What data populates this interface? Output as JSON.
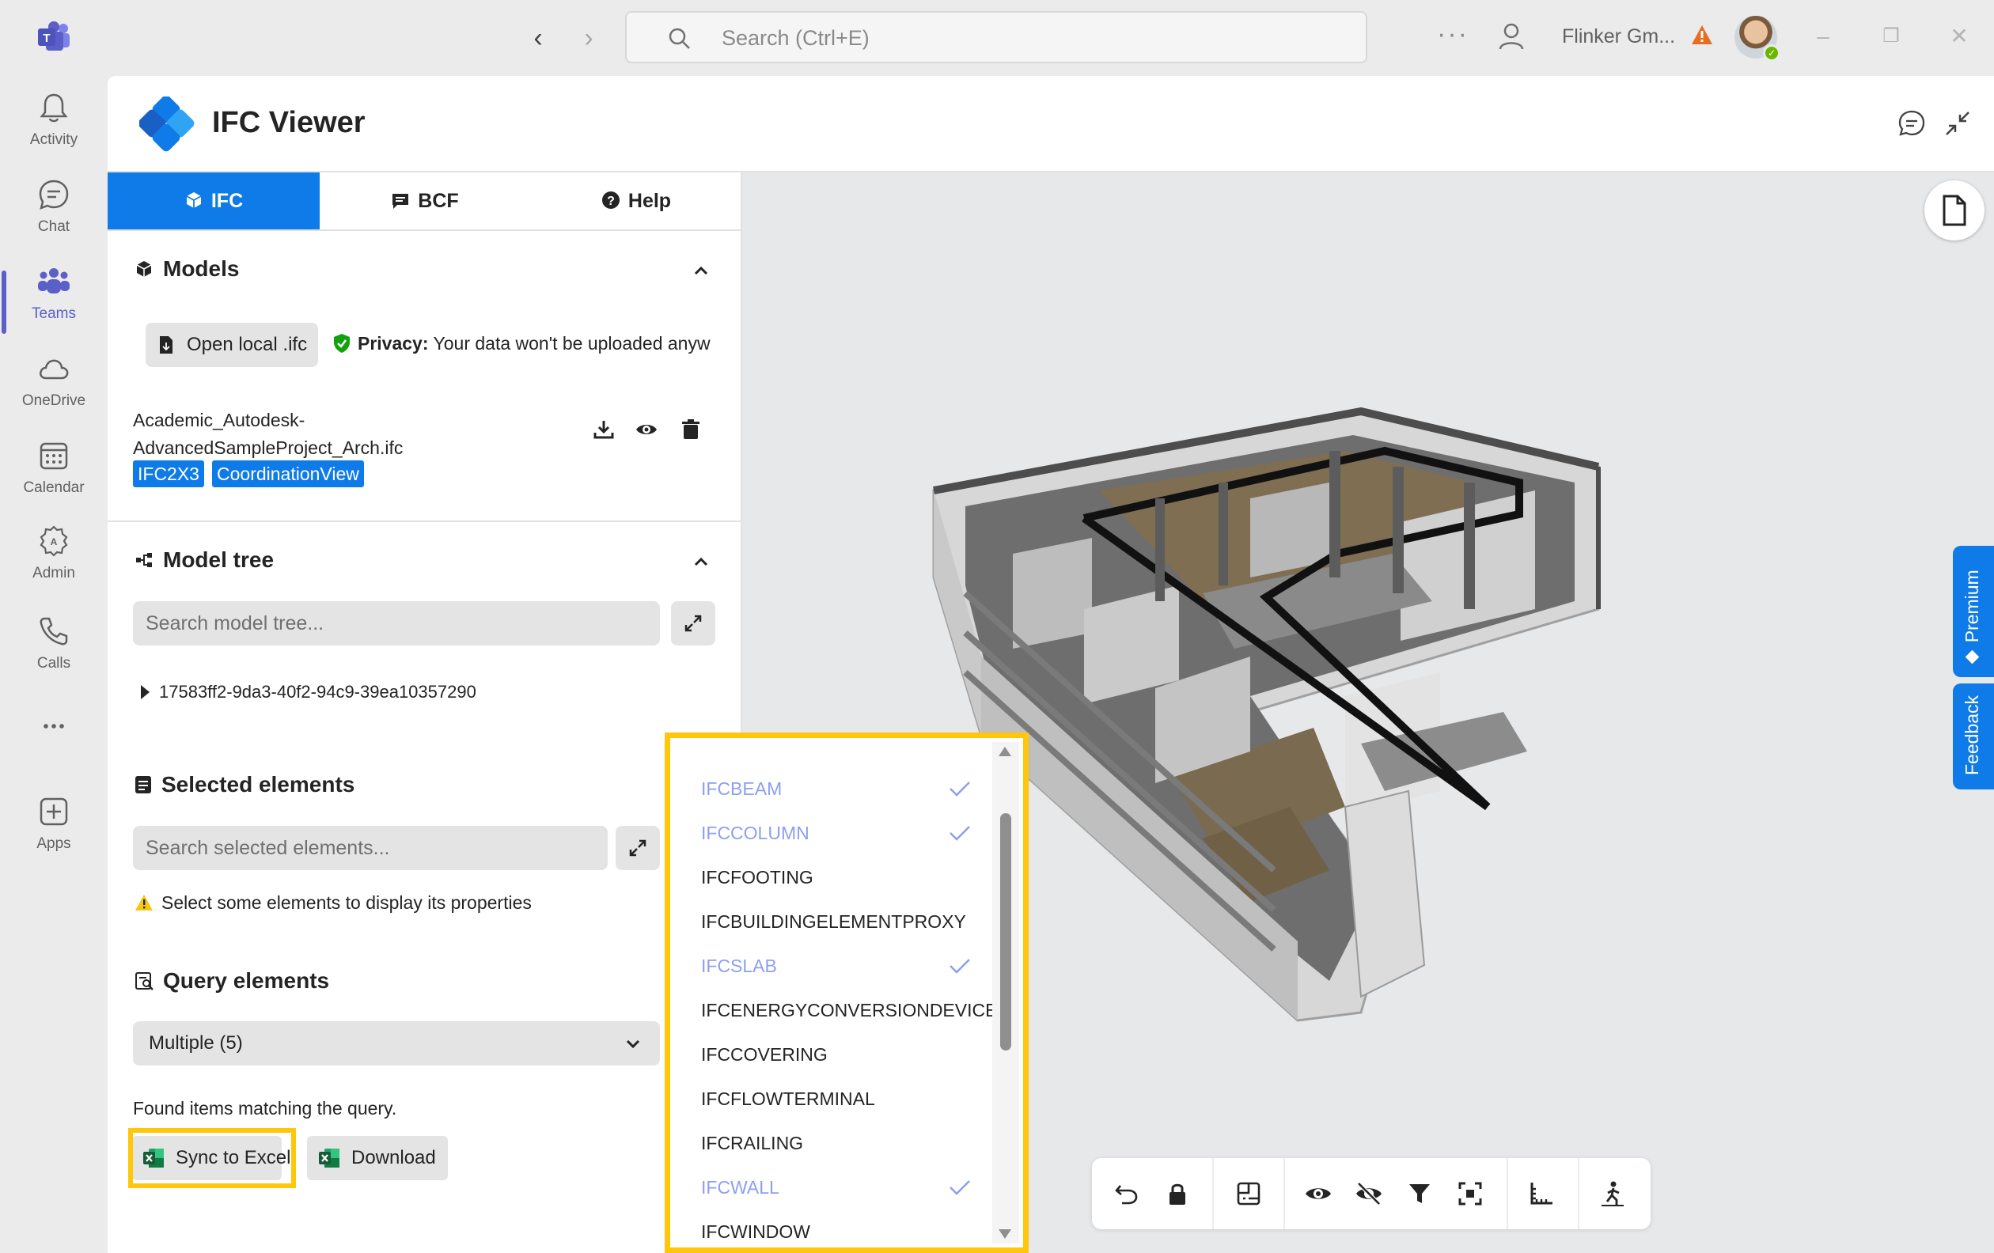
{
  "titlebar": {
    "search_placeholder": "Search (Ctrl+E)",
    "more": "···",
    "org_name": "Flinker Gm...",
    "icons": [
      "teams-logo-icon",
      "back-arrow-icon",
      "forward-arrow-icon",
      "search-icon",
      "more-icon",
      "people-icon",
      "warning-icon",
      "avatar",
      "minimize-icon",
      "restore-icon",
      "close-icon"
    ]
  },
  "rail": {
    "items": [
      {
        "label": "Activity",
        "icon": "bell-icon"
      },
      {
        "label": "Chat",
        "icon": "chat-icon"
      },
      {
        "label": "Teams",
        "icon": "teams-icon",
        "active": true
      },
      {
        "label": "OneDrive",
        "icon": "cloud-icon"
      },
      {
        "label": "Calendar",
        "icon": "calendar-icon"
      },
      {
        "label": "Admin",
        "icon": "admin-icon"
      },
      {
        "label": "Calls",
        "icon": "phone-icon"
      },
      {
        "label": "",
        "icon": "more-icon"
      },
      {
        "label": "Apps",
        "icon": "add-app-icon"
      }
    ]
  },
  "app": {
    "title": "IFC Viewer",
    "tabs": [
      {
        "label": "IFC",
        "active": true
      },
      {
        "label": "BCF"
      },
      {
        "label": "Help"
      }
    ]
  },
  "models": {
    "title": "Models",
    "open_button": "Open local .ifc",
    "privacy_label": "Privacy:",
    "privacy_text": "Your data won't be uploaded anyw",
    "file_name_line1": "Academic_Autodesk-",
    "file_name_line2": "AdvancedSampleProject_Arch.ifc",
    "badges": [
      "IFC2X3",
      "CoordinationView"
    ]
  },
  "model_tree": {
    "title": "Model tree",
    "search_placeholder": "Search model tree...",
    "root_node": "17583ff2-9da3-40f2-94c9-39ea10357290"
  },
  "selected": {
    "title": "Selected elements",
    "search_placeholder": "Search selected elements...",
    "hint": "Select some elements to display its properties"
  },
  "query": {
    "title": "Query elements",
    "select_value": "Multiple (5)",
    "found_text": "Found items matching the query.",
    "sync_button": "Sync to Excel",
    "download_button": "Download"
  },
  "dropdown": {
    "items": [
      {
        "label": "IFCBEAM",
        "selected": true
      },
      {
        "label": "IFCCOLUMN",
        "selected": true
      },
      {
        "label": "IFCFOOTING",
        "selected": false
      },
      {
        "label": "IFCBUILDINGELEMENTPROXY",
        "selected": false
      },
      {
        "label": "IFCSLAB",
        "selected": true
      },
      {
        "label": "IFCENERGYCONVERSIONDEVICE",
        "selected": false
      },
      {
        "label": "IFCCOVERING",
        "selected": false
      },
      {
        "label": "IFCFLOWTERMINAL",
        "selected": false
      },
      {
        "label": "IFCRAILING",
        "selected": false
      },
      {
        "label": "IFCWALL",
        "selected": true
      },
      {
        "label": "IFCWINDOW",
        "selected": false
      }
    ]
  },
  "viewer": {
    "premium_label": "Premium",
    "feedback_label": "Feedback",
    "toolbar_icons": [
      "undo-icon",
      "lock-icon",
      "floorplan-icon",
      "eye-icon",
      "eye-off-icon",
      "filter-icon",
      "focus-icon",
      "measure-icon",
      "walk-icon"
    ]
  },
  "colors": {
    "accent": "#0f7be8",
    "teams_purple": "#5b5fc7",
    "highlight": "#ffc60b",
    "selected_item": "#8c9ff0"
  }
}
